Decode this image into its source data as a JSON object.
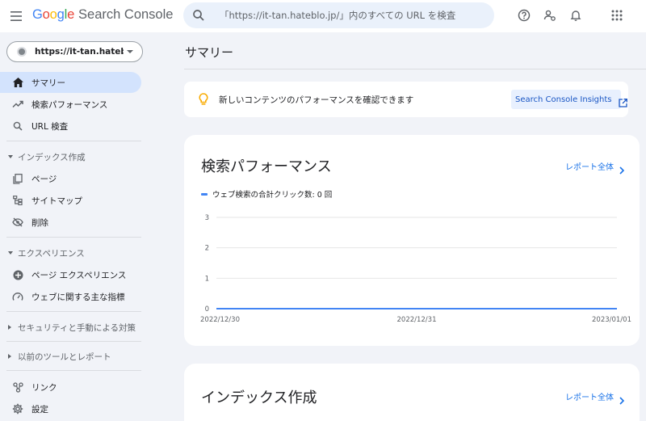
{
  "app": {
    "logo": [
      "G",
      "o",
      "o",
      "g",
      "l",
      "e"
    ],
    "logo_suffix": "Search Console"
  },
  "search": {
    "placeholder": "「https://it-tan.hateblo.jp/」内のすべての URL を検査"
  },
  "property": {
    "label": "https://it-tan.hatebl..."
  },
  "sidebar": {
    "summary": "サマリー",
    "performance": "検索パフォーマンス",
    "url_inspection": "URL 検査",
    "indexing": "インデックス作成",
    "pages": "ページ",
    "sitemaps": "サイトマップ",
    "removals": "削除",
    "experience": "エクスペリエンス",
    "page_experience": "ページ エクスペリエンス",
    "core_web_vitals": "ウェブに関する主な指標",
    "security": "セキュリティと手動による対策",
    "legacy": "以前のツールとレポート",
    "links": "リンク",
    "settings": "設定"
  },
  "main": {
    "page_title": "サマリー",
    "insight_text": "新しいコンテンツのパフォーマンスを確認できます",
    "insights_button": "Search Console Insights",
    "performance_title": "検索パフォーマンス",
    "report_all": "レポート全体",
    "index_title": "インデックス作成"
  },
  "chart_data": {
    "type": "line",
    "series": [
      {
        "name": "ウェブ検索の合計クリック数: 0 回",
        "values": [
          0,
          0,
          0
        ]
      }
    ],
    "x": [
      "2022/12/30",
      "2022/12/31",
      "2023/01/01"
    ],
    "yticks": [
      0,
      1,
      2,
      3
    ],
    "ylim": [
      0,
      3
    ],
    "grid": true,
    "color": "#4285f4"
  },
  "colors": {
    "accent": "#1a73e8",
    "active_nav": "#d3e3fd",
    "background": "#f1f3f8",
    "line": "#4285f4"
  }
}
